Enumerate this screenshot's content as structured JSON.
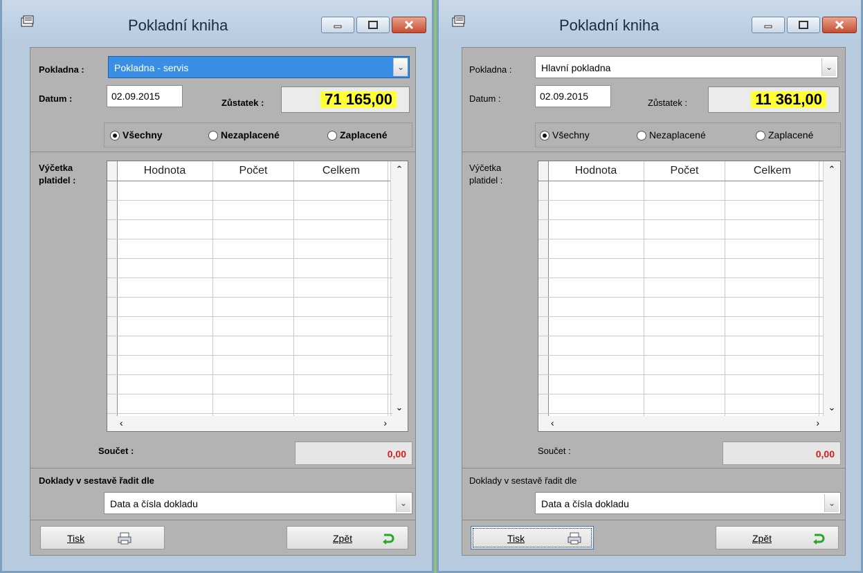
{
  "windows": [
    {
      "title": "Pokladní kniha",
      "pokladna_label": "Pokladna :",
      "pokladna_value": "Pokladna - servis",
      "datum_label": "Datum :",
      "datum_value": "02.09.2015",
      "zustatek_label": "Zůstatek :",
      "zustatek_value": "71 165,00",
      "radios": [
        "Všechny",
        "Nezaplacené",
        "Zaplacené"
      ],
      "vycetka_label": "Výčetka platidel :",
      "grid_headers": [
        "Hodnota",
        "Počet",
        "Celkem"
      ],
      "soucet_label": "Součet :",
      "soucet_value": "0,00",
      "doklady_label": "Doklady v sestavě řadit dle",
      "doklady_value": "Data a čísla dokladu",
      "tisk_label": "Tisk",
      "zpet_label": "Zpět"
    },
    {
      "title": "Pokladní kniha",
      "pokladna_label": "Pokladna :",
      "pokladna_value": "Hlavní pokladna",
      "datum_label": "Datum :",
      "datum_value": "02.09.2015",
      "zustatek_label": "Zůstatek :",
      "zustatek_value": "11 361,00",
      "radios": [
        "Všechny",
        "Nezaplacené",
        "Zaplacené"
      ],
      "vycetka_label": "Výčetka platidel :",
      "grid_headers": [
        "Hodnota",
        "Počet",
        "Celkem"
      ],
      "soucet_label": "Součet :",
      "soucet_value": "0,00",
      "doklady_label": "Doklady v sestavě řadit dle",
      "doklady_value": "Data a čísla dokladu",
      "tisk_label": "Tisk",
      "zpet_label": "Zpět"
    }
  ],
  "colors": {
    "highlight": "#ffff33",
    "sum_red": "#d61d1d",
    "selected": "#3a8ee6"
  },
  "icons": [
    "cash-book-icon",
    "minimize-icon",
    "maximize-icon",
    "close-icon",
    "chevron-down-icon",
    "printer-icon",
    "return-arrow-icon"
  ]
}
